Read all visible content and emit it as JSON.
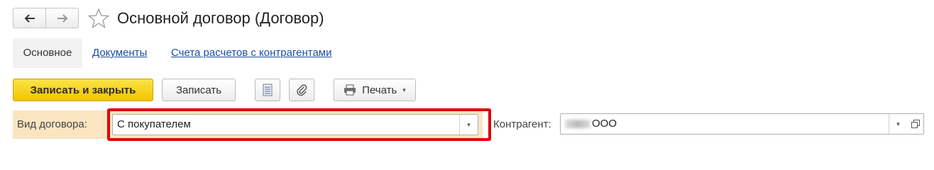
{
  "header": {
    "back_icon": "arrow-left-icon",
    "forward_icon": "arrow-right-icon",
    "favorite_icon": "star-icon",
    "title": "Основной договор (Договор)"
  },
  "tabs": [
    {
      "label": "Основное",
      "active": true
    },
    {
      "label": "Документы",
      "active": false
    },
    {
      "label": "Счета расчетов с контрагентами",
      "active": false
    }
  ],
  "toolbar": {
    "save_close_label": "Записать и закрыть",
    "save_label": "Записать",
    "list_icon": "list-icon",
    "attach_icon": "paperclip-icon",
    "print_icon": "printer-icon",
    "print_label": "Печать",
    "print_caret": "▾"
  },
  "form": {
    "contract_type": {
      "label": "Вид договора:",
      "value": "С покупателем",
      "dropdown_caret": "▾"
    },
    "counterparty": {
      "label": "Контрагент:",
      "value": "ООО",
      "dropdown_caret": "▾",
      "open_icon": "open-window-icon"
    }
  },
  "colors": {
    "primary_button": "#f2c300",
    "highlight_border": "#e00000",
    "field_row_background": "#fbe5c1",
    "link": "#1a4fa0"
  }
}
